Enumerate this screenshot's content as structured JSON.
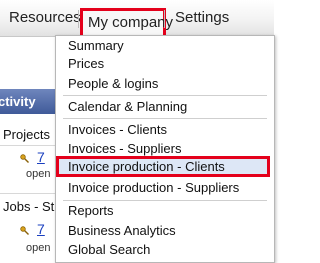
{
  "topnav": {
    "resources": "Resources",
    "my_company": "My company",
    "settings": "Settings"
  },
  "background": {
    "activity": "ctivity",
    "projects": "Projects",
    "link1": "7",
    "sub1": "open",
    "jobs": "Jobs - St",
    "link2": "7",
    "sub2": "open"
  },
  "dropdown": {
    "items": [
      "Summary",
      "Prices",
      "People & logins",
      "Calendar & Planning",
      "Invoices - Clients",
      "Invoices - Suppliers",
      "Invoice production - Clients",
      "Invoice production - Suppliers",
      "Reports",
      "Business Analytics",
      "Global Search"
    ],
    "highlighted_index": 6
  },
  "colors": {
    "highlight_border": "#e4001b",
    "highlight_bg": "#dde7f6",
    "activity_bar": "#3f5a99",
    "link": "#1a3fbf"
  }
}
